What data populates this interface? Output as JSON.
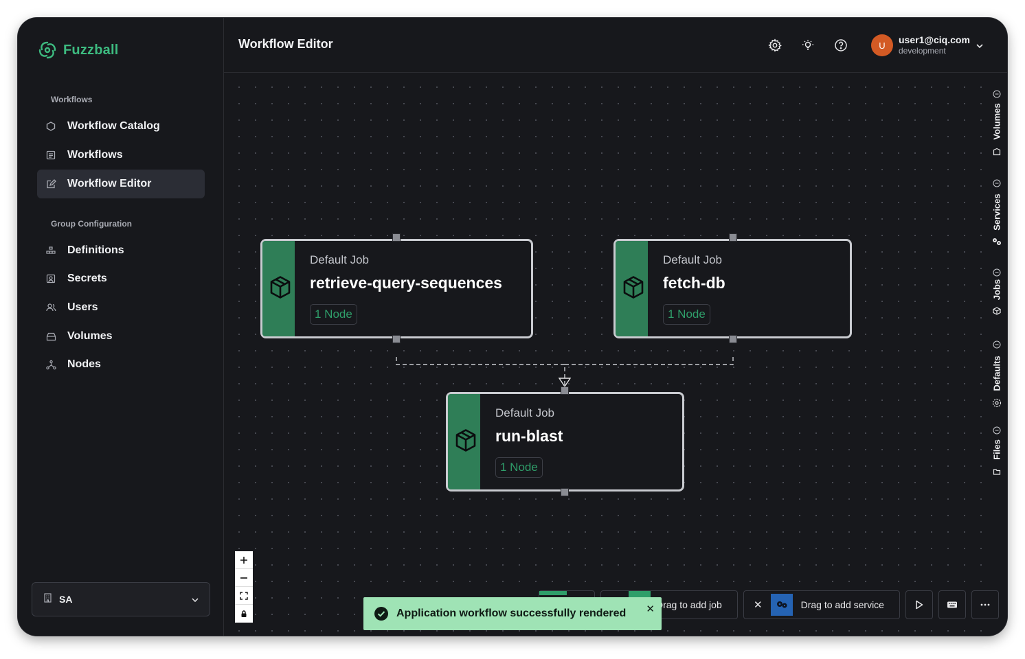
{
  "app": {
    "name": "Fuzzball"
  },
  "sidebar": {
    "workflows_section": "Workflows",
    "workflow_items": [
      {
        "label": "Workflow Catalog",
        "icon": "hexagon-icon"
      },
      {
        "label": "Workflows",
        "icon": "list-icon"
      },
      {
        "label": "Workflow Editor",
        "icon": "edit-icon",
        "active": true
      }
    ],
    "group_section": "Group Configuration",
    "group_items": [
      {
        "label": "Definitions",
        "icon": "definitions-icon"
      },
      {
        "label": "Secrets",
        "icon": "secrets-icon"
      },
      {
        "label": "Users",
        "icon": "users-icon"
      },
      {
        "label": "Volumes",
        "icon": "volumes-icon"
      },
      {
        "label": "Nodes",
        "icon": "nodes-icon"
      }
    ],
    "org_select": {
      "value": "SA"
    }
  },
  "header": {
    "title": "Workflow Editor",
    "user": {
      "initial": "U",
      "email": "user1@ciq.com",
      "environment": "development"
    }
  },
  "canvas": {
    "jobs": [
      {
        "kind": "Default Job",
        "name": "retrieve-query-sequences",
        "nodes": "1 Node"
      },
      {
        "kind": "Default Job",
        "name": "fetch-db",
        "nodes": "1 Node"
      },
      {
        "kind": "Default Job",
        "name": "run-blast",
        "nodes": "1 Node"
      }
    ]
  },
  "right_rail": {
    "tabs": [
      "Volumes",
      "Services",
      "Jobs",
      "Defaults",
      "Files"
    ]
  },
  "toolbar": {
    "add_job_label": "Drag to add job",
    "add_service_label": "Drag to add service"
  },
  "toast": {
    "message": "Application workflow successfully rendered"
  },
  "colors": {
    "accent": "#3dbb80",
    "job_stripe": "#2f7e57",
    "toast_bg": "#9fe3b5",
    "avatar": "#d35a24"
  }
}
